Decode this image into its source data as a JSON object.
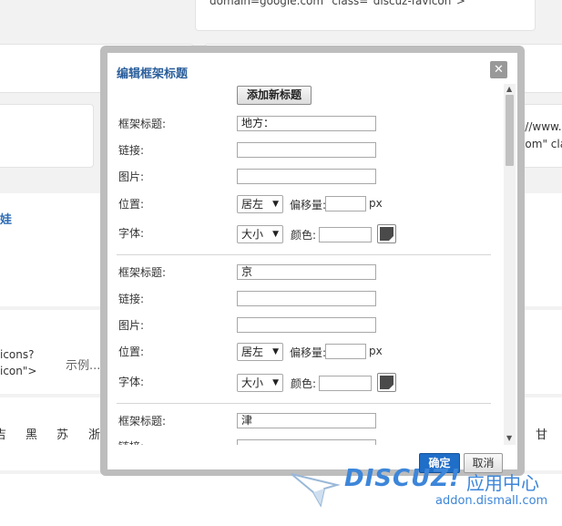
{
  "background": {
    "top_snippet": "domain=google.com\" class=\"discuz-favicon\">",
    "right_snippet_1": "s://www.g",
    "right_snippet_2": ".com\" cla",
    "left_link": "娃",
    "left_snippet_1": "icons?",
    "left_snippet_2": "icon\">",
    "example_label": "示例...",
    "provinces": [
      "吉",
      "黑",
      "苏",
      "浙"
    ],
    "right_province": "甘"
  },
  "dialog": {
    "title": "编辑框架标题",
    "close_icon": "close-icon",
    "add_button": "添加新标题",
    "labels": {
      "frame_title": "框架标题:",
      "link": "链接:",
      "image": "图片:",
      "position": "位置:",
      "font": "字体:",
      "offset": "偏移量:",
      "px": "px",
      "color": "颜色:"
    },
    "groups": [
      {
        "title_value": "地方：",
        "link_value": "",
        "image_value": "",
        "position": "居左",
        "size": "大小",
        "offset": "",
        "color": "#4a4a4a"
      },
      {
        "title_value": "京",
        "link_value": "",
        "image_value": "",
        "position": "居左",
        "size": "大小",
        "offset": "",
        "color": "#4a4a4a"
      },
      {
        "title_value": "津",
        "link_value": ""
      }
    ],
    "ok_button": "确定",
    "cancel_button": "取消"
  },
  "watermark": {
    "brand": "DISCUZ!",
    "cn": "应用中心",
    "url": "addon.dismall.com"
  }
}
